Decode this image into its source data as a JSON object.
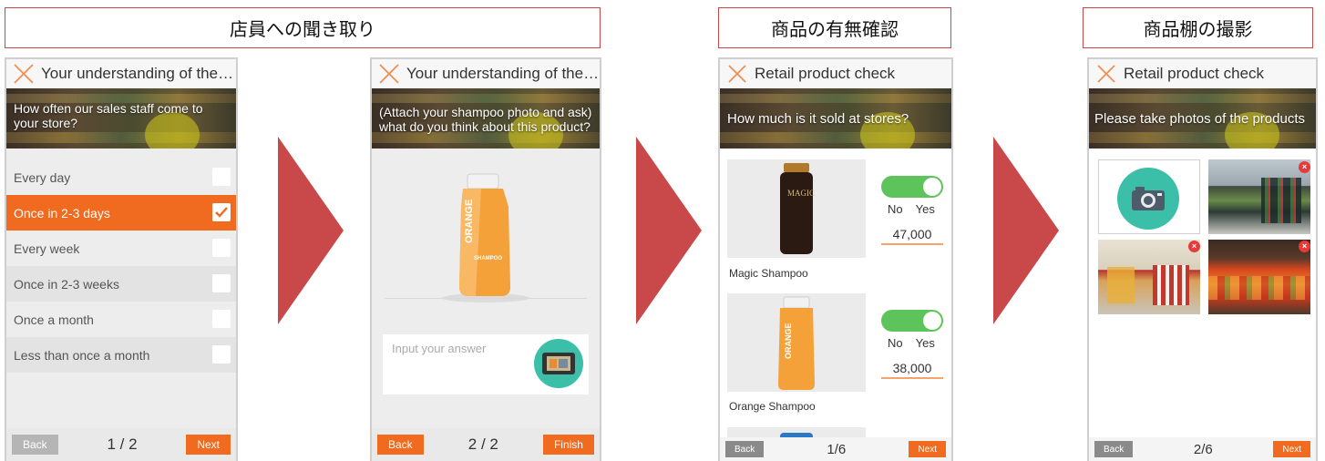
{
  "captions": {
    "interview": "店員への聞き取り",
    "availability": "商品の有無確認",
    "shelf_photo": "商品棚の撮影"
  },
  "colors": {
    "accent": "#f06a1f",
    "arrow": "#c9484a",
    "toggle_on": "#5cc45a",
    "camera_teal": "#3bbfa8"
  },
  "screen1": {
    "title": "Your understanding of the ne...",
    "question": "How often our sales staff come to your store?",
    "options": [
      {
        "label": "Every day",
        "checked": false
      },
      {
        "label": "Once in 2-3 days",
        "checked": true
      },
      {
        "label": "Every week",
        "checked": false
      },
      {
        "label": "Once in 2-3 weeks",
        "checked": false
      },
      {
        "label": "Once a month",
        "checked": false
      },
      {
        "label": "Less than once a month",
        "checked": false
      }
    ],
    "back": "Back",
    "pager": "1 / 2",
    "next": "Next"
  },
  "screen2": {
    "title": "Your understanding of the ne...",
    "question": "(Attach your shampoo photo and ask) what do you think about this product?",
    "product_label": "ORANGE",
    "product_sub": "SHAMPOO",
    "answer_placeholder": "Input your answer",
    "back": "Back",
    "pager": "2 / 2",
    "finish": "Finish"
  },
  "screen3": {
    "title": "Retail product check",
    "question": "How much is it sold at stores?",
    "products": [
      {
        "name": "Magic Shampoo",
        "label": "MAGIC",
        "no": "No",
        "yes": "Yes",
        "price": "47,000"
      },
      {
        "name": "Orange Shampoo",
        "label": "ORANGE",
        "no": "No",
        "yes": "Yes",
        "price": "38,000"
      }
    ],
    "back": "Back",
    "pager": "1/6",
    "next": "Next"
  },
  "screen4": {
    "title": "Retail product check",
    "question": "Please take photos of the products",
    "back": "Back",
    "pager": "2/6",
    "next": "Next"
  }
}
